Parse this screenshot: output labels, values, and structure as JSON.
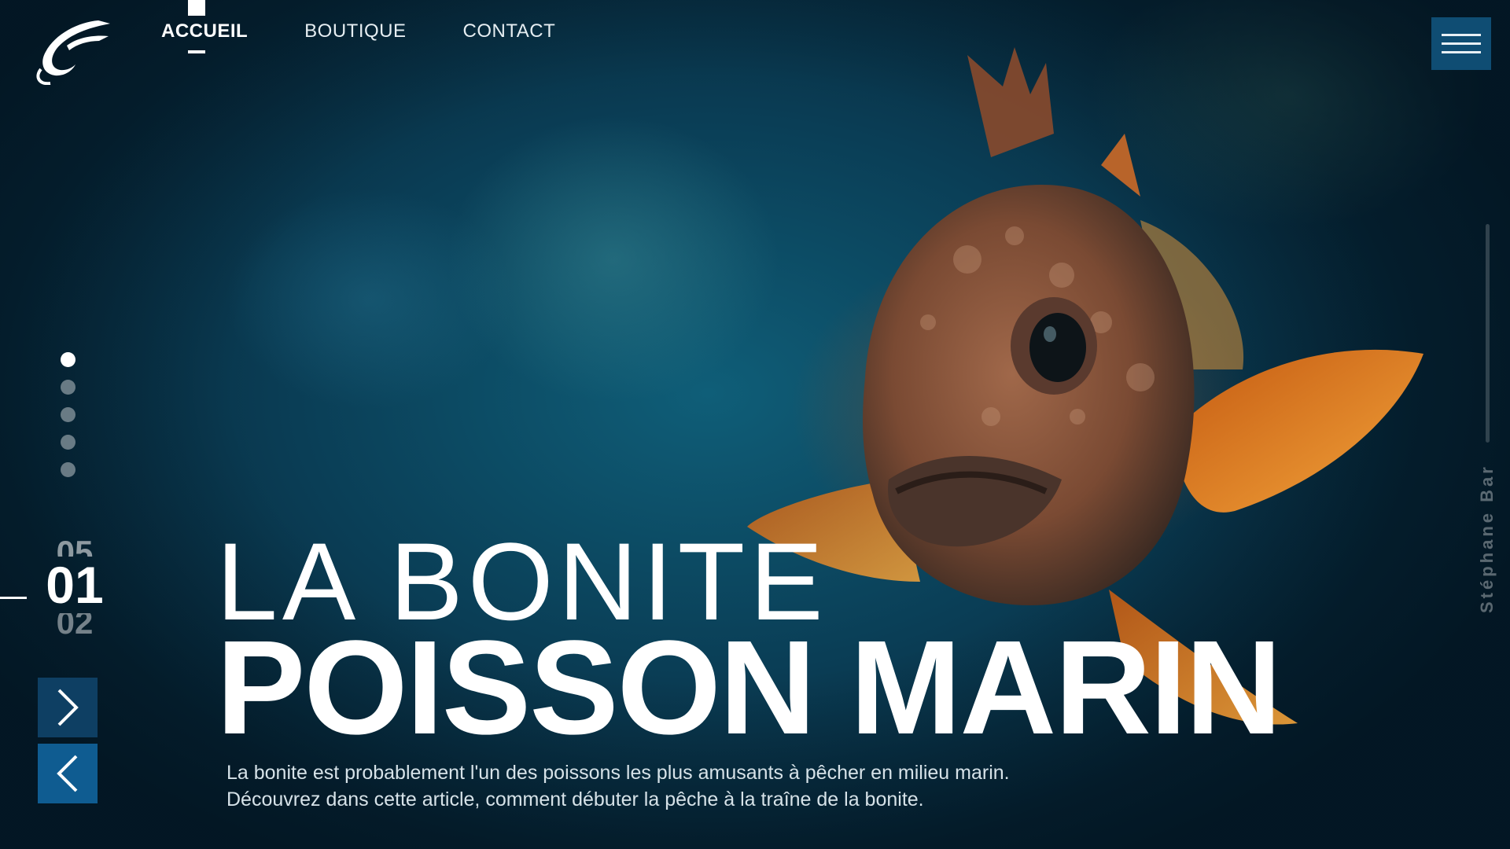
{
  "nav": {
    "items": [
      {
        "label": "ACCUEIL",
        "active": true
      },
      {
        "label": "BOUTIQUE",
        "active": false
      },
      {
        "label": "CONTACT",
        "active": false
      }
    ]
  },
  "icons": {
    "logo": "fish-hook-logo",
    "menu": "hamburger-icon",
    "next": "chevron-right-icon",
    "prev": "chevron-left-icon"
  },
  "slider": {
    "total_dots": 5,
    "active_dot": 1,
    "counter_prev": "05",
    "counter_current": "01",
    "counter_next": "02"
  },
  "hero": {
    "title_line1": "LA BONITE",
    "title_line2": "POISSON MARIN",
    "description_line1": "La bonite est probablement l'un des poissons les plus amusants à pêcher en milieu marin.",
    "description_line2": "Découvrez dans cette article, comment débuter la pêche à la traîne de la bonite."
  },
  "author": "Stéphane Bar",
  "colors": {
    "menu_button": "#0f4d73",
    "next_button": "#0e3f63",
    "prev_button": "#0f5c91",
    "background": "#0a3d55"
  }
}
